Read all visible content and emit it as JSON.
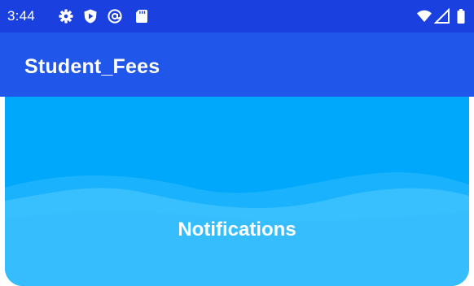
{
  "status_bar": {
    "time": "3:44",
    "icons": [
      "gear-icon",
      "shield-icon",
      "at-sign-icon",
      "sd-card-icon",
      "wifi-icon",
      "cell-signal-icon",
      "battery-icon"
    ],
    "background_color": "#1a40e0"
  },
  "app_bar": {
    "title": "Student_Fees",
    "background_color": "#2156ea"
  },
  "banner": {
    "title": "Notifications",
    "background_color": "#00a8fb",
    "wave_color_light": "#3cc0fd"
  }
}
